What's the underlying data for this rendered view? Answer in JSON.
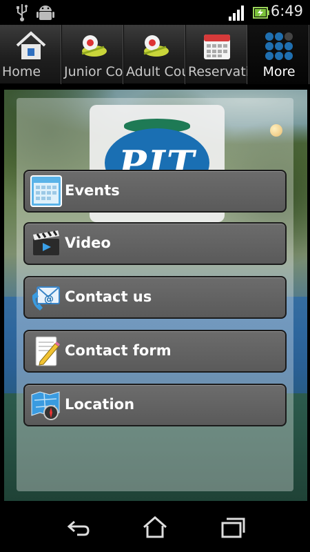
{
  "status_bar": {
    "time": "6:49",
    "icons": [
      "usb-icon",
      "android-debug-icon",
      "signal-icon",
      "battery-charging-icon"
    ]
  },
  "tabs": [
    {
      "label": "Home",
      "icon": "home-icon",
      "active": false
    },
    {
      "label": "Junior Co",
      "icon": "tennis-balls-icon",
      "active": false
    },
    {
      "label": "Adult Cou",
      "icon": "tennis-balls-icon",
      "active": false
    },
    {
      "label": "Reservatio",
      "icon": "calendar-icon",
      "active": false
    },
    {
      "label": "More",
      "icon": "grid-dots-icon",
      "active": true
    }
  ],
  "logo": {
    "text": "PIT"
  },
  "menu": [
    {
      "label": "Events",
      "icon": "event-calendar-icon"
    },
    {
      "label": "Video",
      "icon": "clapperboard-icon"
    },
    {
      "label": "Contact us",
      "icon": "phone-email-icon"
    },
    {
      "label": "Contact form",
      "icon": "form-pencil-icon"
    },
    {
      "label": "Location",
      "icon": "map-compass-icon"
    }
  ],
  "nav": [
    "back-icon",
    "home-icon",
    "recent-apps-icon"
  ],
  "colors": {
    "menu_bg": "#636363",
    "logo_blue": "#1a6fb3",
    "logo_green": "#1e7a55"
  }
}
